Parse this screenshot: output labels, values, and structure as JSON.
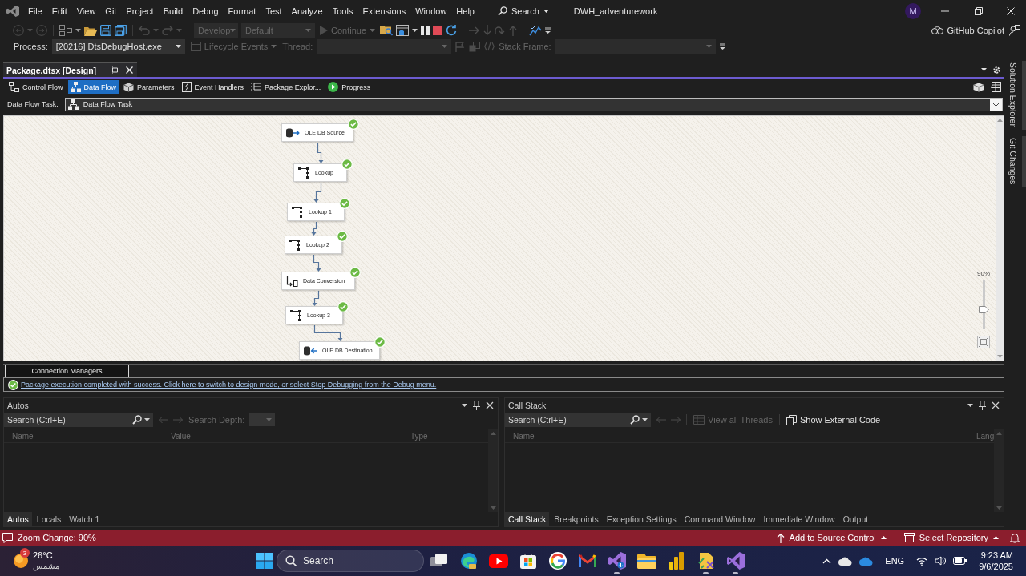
{
  "title_bar": {
    "menu": [
      "File",
      "Edit",
      "View",
      "Git",
      "Project",
      "Build",
      "Debug",
      "Format",
      "Test",
      "Analyze",
      "Tools",
      "Extensions",
      "Window",
      "Help"
    ],
    "search": "Search",
    "solution_name": "DWH_adventurework",
    "avatar": "M"
  },
  "standard_toolbar": {
    "configuration": {
      "value": "Develop",
      "disabled": true
    },
    "platform": {
      "value": "Default",
      "disabled": true
    },
    "continue": {
      "label": "Continue",
      "disabled": true
    },
    "copilot": "GitHub Copilot"
  },
  "debug_location_toolbar": {
    "process_label": "Process:",
    "process": "[20216] DtsDebugHost.exe",
    "lifecycle_events": {
      "label": "Lifecycle Events",
      "disabled": true
    },
    "thread": {
      "label": "Thread:",
      "disabled": true
    },
    "stack_frame": {
      "label": "Stack Frame:",
      "disabled": true
    }
  },
  "document_tabs": [
    {
      "label": "Package.dtsx [Design]",
      "selected": true
    }
  ],
  "designer_tabs": [
    {
      "label": "Control Flow",
      "kind": "control-flow",
      "selected": false
    },
    {
      "label": "Data Flow",
      "kind": "data-flow",
      "selected": true
    },
    {
      "label": "Parameters",
      "kind": "parameters",
      "selected": false
    },
    {
      "label": "Event Handlers",
      "kind": "event-handlers",
      "selected": false
    },
    {
      "label": "Package Explor...",
      "kind": "package-explorer",
      "selected": false
    },
    {
      "label": "Progress",
      "kind": "progress",
      "selected": false
    }
  ],
  "task_selector": {
    "label": "Data Flow Task:",
    "value": "Data Flow Task"
  },
  "canvas": {
    "nodes": [
      {
        "label": "OLE DB Source",
        "kind": "source",
        "succeeded": true
      },
      {
        "label": "Lookup",
        "kind": "lookup",
        "succeeded": true
      },
      {
        "label": "Lookup 1",
        "kind": "lookup",
        "succeeded": true
      },
      {
        "label": "Lookup 2",
        "kind": "lookup",
        "succeeded": true
      },
      {
        "label": "Data Conversion",
        "kind": "conversion",
        "succeeded": true
      },
      {
        "label": "Lookup 3",
        "kind": "lookup",
        "succeeded": true
      },
      {
        "label": "OLE DB Destination",
        "kind": "destination",
        "succeeded": true
      }
    ],
    "zoom": {
      "label": "90%",
      "level": 0.4
    }
  },
  "connection_managers_tab": "Connection Managers",
  "message_bar": {
    "kind": "success",
    "text": "Package execution completed with success. Click here to switch to design mode, or select Stop Debugging from the Debug menu."
  },
  "autos_panel": {
    "title": "Autos",
    "search_placeholder": "Search (Ctrl+E)",
    "search_depth": {
      "label": "Search Depth:",
      "disabled": true
    },
    "columns": [
      "Name",
      "Value",
      "Type"
    ],
    "tabs": [
      {
        "label": "Autos",
        "selected": true
      },
      {
        "label": "Locals",
        "selected": false
      },
      {
        "label": "Watch 1",
        "selected": false
      }
    ]
  },
  "call_stack_panel": {
    "title": "Call Stack",
    "search_placeholder": "Search (Ctrl+E)",
    "view_all_threads": {
      "label": "View all Threads",
      "disabled": true
    },
    "show_external_code": "Show External Code",
    "columns": [
      "Name",
      "Lang"
    ],
    "tabs": [
      {
        "label": "Call Stack",
        "selected": true
      },
      {
        "label": "Breakpoints",
        "selected": false
      },
      {
        "label": "Exception Settings",
        "selected": false
      },
      {
        "label": "Command Window",
        "selected": false
      },
      {
        "label": "Immediate Window",
        "selected": false
      },
      {
        "label": "Output",
        "selected": false
      }
    ]
  },
  "side_tabs": [
    "Solution Explorer",
    "Git Changes"
  ],
  "status_bar": {
    "message": "Zoom Change: 90%",
    "source_control": "Add to Source Control",
    "repository": "Select Repository"
  },
  "taskbar": {
    "weather": {
      "badge": "3",
      "temperature": "26°C",
      "condition": "مشمس"
    },
    "search": "Search",
    "apps": [
      {
        "kind": "task-view",
        "running": false
      },
      {
        "kind": "edge",
        "running": false
      },
      {
        "kind": "youtube",
        "running": false
      },
      {
        "kind": "store",
        "running": false
      },
      {
        "kind": "google",
        "running": false
      },
      {
        "kind": "gmail",
        "running": false
      },
      {
        "kind": "visual-studio-installer",
        "running": true
      },
      {
        "kind": "files",
        "running": false
      },
      {
        "kind": "power-bi",
        "running": false
      },
      {
        "kind": "tool",
        "running": true
      },
      {
        "kind": "visual-studio",
        "running": true
      }
    ],
    "language": "ENG",
    "time": "9:23 AM",
    "date": "9/6/2025"
  }
}
